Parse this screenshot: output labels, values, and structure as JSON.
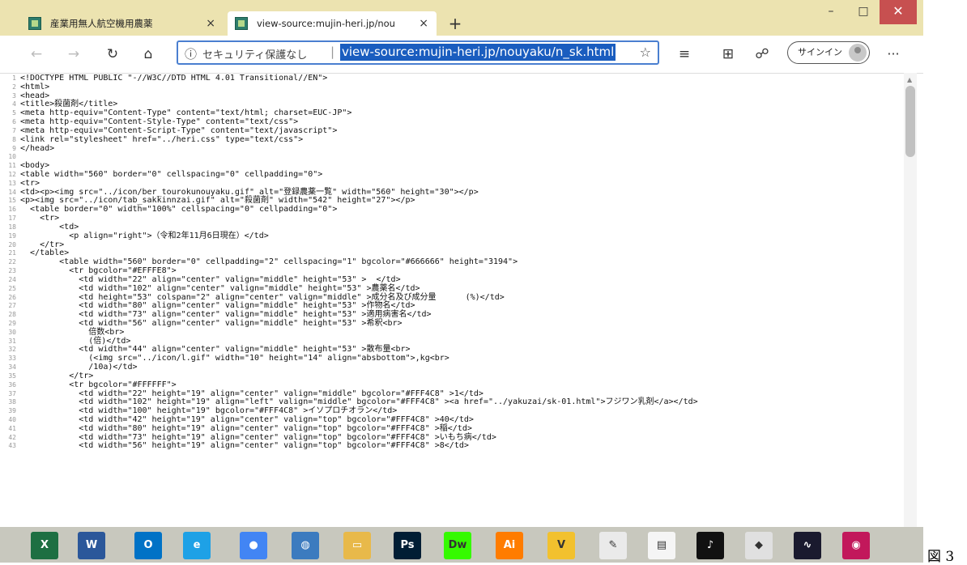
{
  "window_controls": {
    "minimize": "–",
    "maximize": "□",
    "close": "✕"
  },
  "tabs": [
    {
      "title": "産業用無人航空機用農薬",
      "close": "×",
      "favicon": "site-favicon"
    },
    {
      "title": "view-source:mujin-heri.jp/nouyaku",
      "close": "×",
      "favicon": "site-favicon"
    }
  ],
  "new_tab_label": "+",
  "toolbar": {
    "back": "←",
    "forward": "→",
    "refresh": "↻",
    "home": "⌂",
    "info_icon": "ⓘ",
    "security_text": "セキュリティ保護なし",
    "separator": "|",
    "url": "view-source:mujin-heri.jp/nouyaku/n_sk.html",
    "favorite": "☆",
    "favorites_bar": "≡",
    "collections": "⊞",
    "share": "☍",
    "signin_label": "サインイン",
    "more": "···"
  },
  "source_lines": [
    "<!DOCTYPE HTML PUBLIC \"-//W3C//DTD HTML 4.01 Transitional//EN\">",
    "<html>",
    "<head>",
    "<title>殺菌剤</title>",
    "<meta http-equiv=\"Content-Type\" content=\"text/html; charset=EUC-JP\">",
    "<meta http-equiv=\"Content-Style-Type\" content=\"text/css\">",
    "<meta http-equiv=\"Content-Script-Type\" content=\"text/javascript\">",
    "<link rel=\"stylesheet\" href=\"../heri.css\" type=\"text/css\">",
    "</head>",
    "",
    "<body>",
    "<table width=\"560\" border=\"0\" cellspacing=\"0\" cellpadding=\"0\">",
    "<tr>",
    "<td><p><img src=\"../icon/ber_tourokunouyaku.gif\" alt=\"登録農薬一覧\" width=\"560\" height=\"30\"></p>",
    "<p><img src=\"../icon/tab_sakkinnzai.gif\" alt=\"殺菌剤\" width=\"542\" height=\"27\"></p>",
    "  <table border=\"0\" width=\"100%\" cellspacing=\"0\" cellpadding=\"0\">",
    "    <tr>",
    "        <td>",
    "          <p align=\"right\">（令和2年11月6日現在）</td>",
    "    </tr>",
    "  </table>",
    "        <table width=\"560\" border=\"0\" cellpadding=\"2\" cellspacing=\"1\" bgcolor=\"#666666\" height=\"3194\">",
    "          <tr bgcolor=\"#EFFFE8\">",
    "            <td width=\"22\" align=\"center\" valign=\"middle\" height=\"53\" >  </td>",
    "            <td width=\"102\" align=\"center\" valign=\"middle\" height=\"53\" >農薬名</td>",
    "            <td height=\"53\" colspan=\"2\" align=\"center\" valign=\"middle\" >成分名及び成分量      (%)</td>",
    "            <td width=\"80\" align=\"center\" valign=\"middle\" height=\"53\" >作物名</td>",
    "            <td width=\"73\" align=\"center\" valign=\"middle\" height=\"53\" >適用病害名</td>",
    "            <td width=\"56\" align=\"center\" valign=\"middle\" height=\"53\" >希釈<br>",
    "              倍数<br>",
    "              (倍)</td>",
    "            <td width=\"44\" align=\"center\" valign=\"middle\" height=\"53\" >散布量<br>",
    "              (<img src=\"../icon/l.gif\" width=\"10\" height=\"14\" align=\"absbottom\">,kg<br>",
    "              /10a)</td>",
    "          </tr>",
    "          <tr bgcolor=\"#FFFFFF\">",
    "            <td width=\"22\" height=\"19\" align=\"center\" valign=\"middle\" bgcolor=\"#FFF4C8\" >1</td>",
    "            <td width=\"102\" height=\"19\" align=\"left\" valign=\"middle\" bgcolor=\"#FFF4C8\" ><a href=\"../yakuzai/sk-01.html\">フジワン乳剤</a></td>",
    "            <td width=\"100\" height=\"19\" bgcolor=\"#FFF4C8\" >イソプロチオラン</td>",
    "            <td width=\"42\" height=\"19\" align=\"center\" valign=\"top\" bgcolor=\"#FFF4C8\" >40</td>",
    "            <td width=\"80\" height=\"19\" align=\"center\" valign=\"top\" bgcolor=\"#FFF4C8\" >稲</td>",
    "            <td width=\"73\" height=\"19\" align=\"center\" valign=\"top\" bgcolor=\"#FFF4C8\" >いもち病</td>",
    "            <td width=\"56\" height=\"19\" align=\"center\" valign=\"top\" bgcolor=\"#FFF4C8\" >8</td>"
  ],
  "taskbar_items": [
    {
      "name": "excel-icon",
      "label": "X",
      "color": "#1d6f42"
    },
    {
      "name": "word-icon",
      "label": "W",
      "color": "#2b579a"
    },
    {
      "name": "outlook-icon",
      "label": "O",
      "color": "#0072c6"
    },
    {
      "name": "ie-icon",
      "label": "e",
      "color": "#1ea1e6"
    },
    {
      "name": "chrome-icon",
      "label": "●",
      "color": "#4285f4"
    },
    {
      "name": "network-icon",
      "label": "◍",
      "color": "#3c7bbf"
    },
    {
      "name": "file-explorer-icon",
      "label": "▭",
      "color": "#e8b94a"
    },
    {
      "name": "photoshop-icon",
      "label": "Ps",
      "color": "#001d34"
    },
    {
      "name": "dreamweaver-icon",
      "label": "Dw",
      "color": "#35fa00"
    },
    {
      "name": "illustrator-icon",
      "label": "Ai",
      "color": "#ff7c00"
    },
    {
      "name": "vectorworks-icon",
      "label": "V",
      "color": "#f2c12e"
    },
    {
      "name": "notepad-icon",
      "label": "✎",
      "color": "#eaeaea"
    },
    {
      "name": "document-icon",
      "label": "▤",
      "color": "#f5f5f5"
    },
    {
      "name": "music-app-icon",
      "label": "♪",
      "color": "#111111"
    },
    {
      "name": "paint-app-icon",
      "label": "◆",
      "color": "#e0e0e0"
    },
    {
      "name": "audio-editor-icon",
      "label": "∿",
      "color": "#1a1a2e"
    },
    {
      "name": "media-player-icon",
      "label": "◉",
      "color": "#c2185b"
    }
  ],
  "caption": "図 3"
}
